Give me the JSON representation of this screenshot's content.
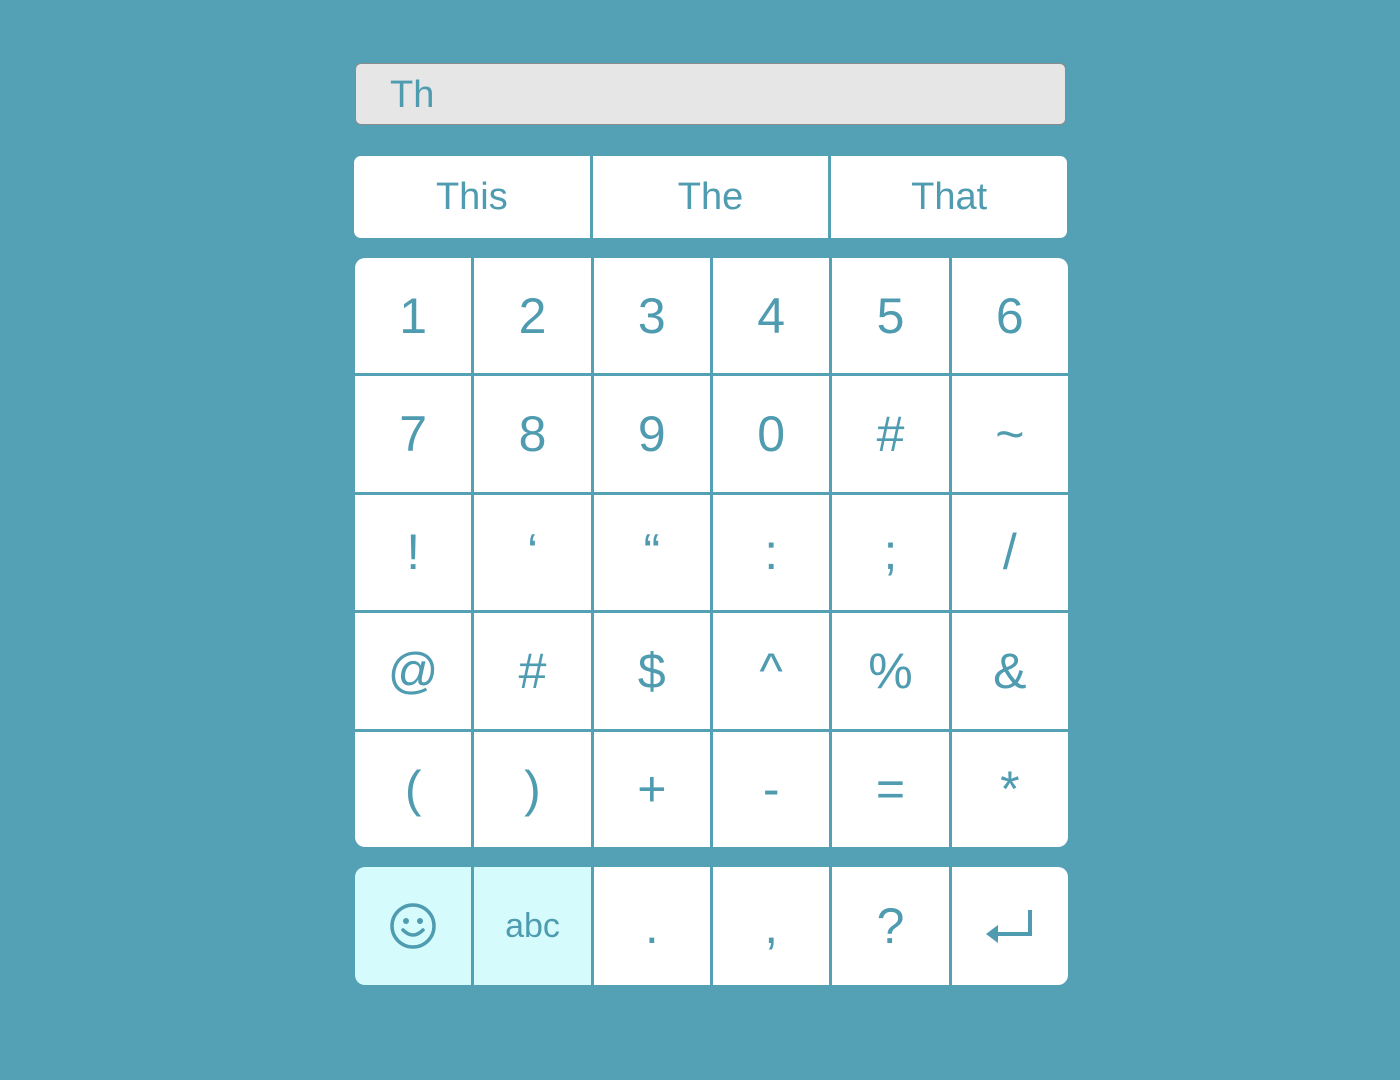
{
  "input": {
    "value": "Th"
  },
  "suggestions": [
    "This",
    "The",
    "That"
  ],
  "keys": [
    [
      "1",
      "2",
      "3",
      "4",
      "5",
      "6"
    ],
    [
      "7",
      "8",
      "9",
      "0",
      "#",
      "~"
    ],
    [
      "!",
      "‘",
      "“",
      ":",
      ";",
      "/"
    ],
    [
      "@",
      "#",
      "$",
      "^",
      "%",
      "&"
    ],
    [
      "(",
      ")",
      "+",
      "-",
      "=",
      "*"
    ]
  ],
  "bottom_row": {
    "emoji_icon": "smiley-icon",
    "abc_label": "abc",
    "period": ".",
    "comma": ",",
    "question": "?",
    "enter_icon": "return-arrow-icon"
  },
  "colors": {
    "background": "#54a0b5",
    "text_accent": "#4f9bb0",
    "key_background": "#ffffff",
    "mode_key_background": "#d6fbfd",
    "input_background": "#e6e6e6"
  }
}
